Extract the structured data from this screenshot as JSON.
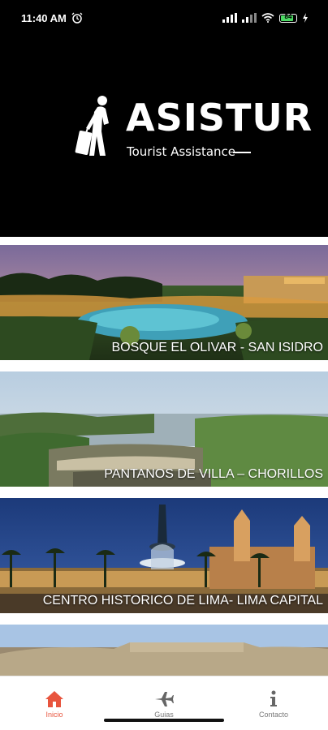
{
  "status": {
    "time": "11:40 AM",
    "battery": "84"
  },
  "brand": {
    "title": "ASISTUR",
    "subtitle": "Tourist Assistance"
  },
  "places": [
    {
      "label": "BOSQUE EL OLIVAR - SAN ISIDRO"
    },
    {
      "label": "PANTANOS DE VILLA – CHORILLOS"
    },
    {
      "label": "CENTRO HISTORICO DE LIMA- LIMA CAPITAL"
    },
    {
      "label": ""
    }
  ],
  "nav": {
    "items": [
      {
        "label": "Inicio",
        "icon": "home-icon",
        "active": true
      },
      {
        "label": "Guias",
        "icon": "airplane-icon",
        "active": false
      },
      {
        "label": "Contacto",
        "icon": "info-icon",
        "active": false
      }
    ]
  },
  "colors": {
    "accent": "#e8553e",
    "header_bg": "#000000"
  }
}
